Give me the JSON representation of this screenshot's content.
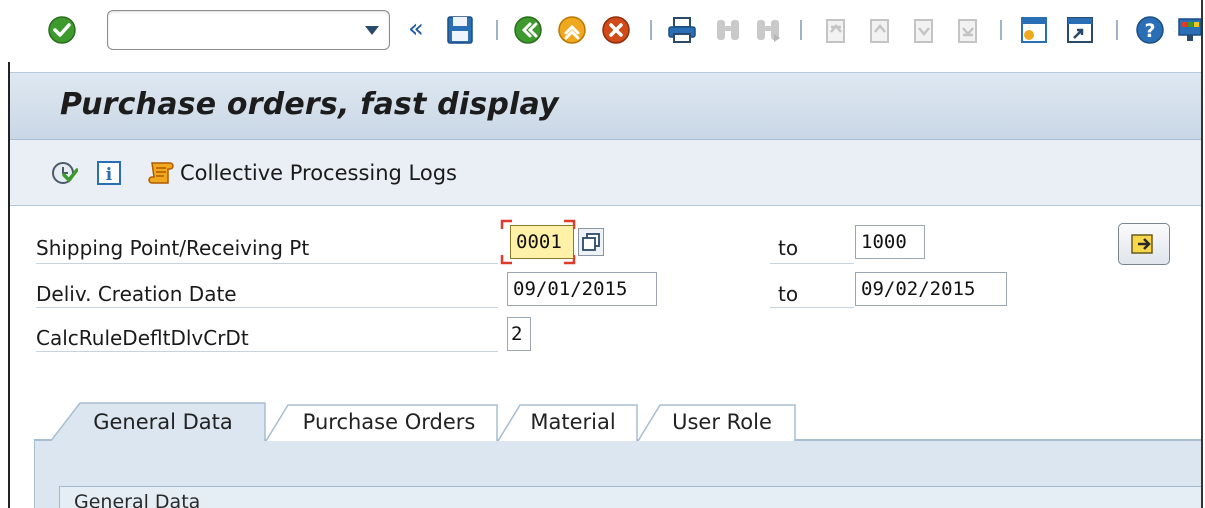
{
  "toolbar": {
    "command_field_value": "",
    "icons": [
      "enter-icon",
      "command-dropdown-icon",
      "collapse-icon",
      "save-icon",
      "back-icon",
      "exit-icon",
      "cancel-icon",
      "print-icon",
      "find-icon",
      "find-next-icon",
      "first-page-icon",
      "previous-page-icon",
      "next-page-icon",
      "last-page-icon",
      "create-session-icon",
      "shortcut-icon",
      "help-icon",
      "customize-layout-icon"
    ]
  },
  "title": "Purchase orders, fast display",
  "app_toolbar": {
    "execute_icon": "clock-execute-icon",
    "info_icon": "info-icon",
    "logs_label": "Collective Processing Logs"
  },
  "selection": {
    "rows": [
      {
        "label": "Shipping Point/Receiving Pt",
        "from": "0001",
        "to_label": "to",
        "to": "1000"
      },
      {
        "label": "Deliv. Creation Date",
        "from": "09/01/2015",
        "to_label": "to",
        "to": "09/02/2015"
      },
      {
        "label": "CalcRuleDefltDlvCrDt",
        "from": "2"
      }
    ]
  },
  "tabs": {
    "items": [
      "General Data",
      "Purchase Orders",
      "Material",
      "User Role"
    ],
    "active": 0,
    "group_title": "General Data"
  },
  "colors": {
    "title_bar": "#c9d7e6",
    "focus_field": "#fff2a8",
    "tab_active": "#dbe6f0",
    "accent": "#1e5aa0"
  }
}
